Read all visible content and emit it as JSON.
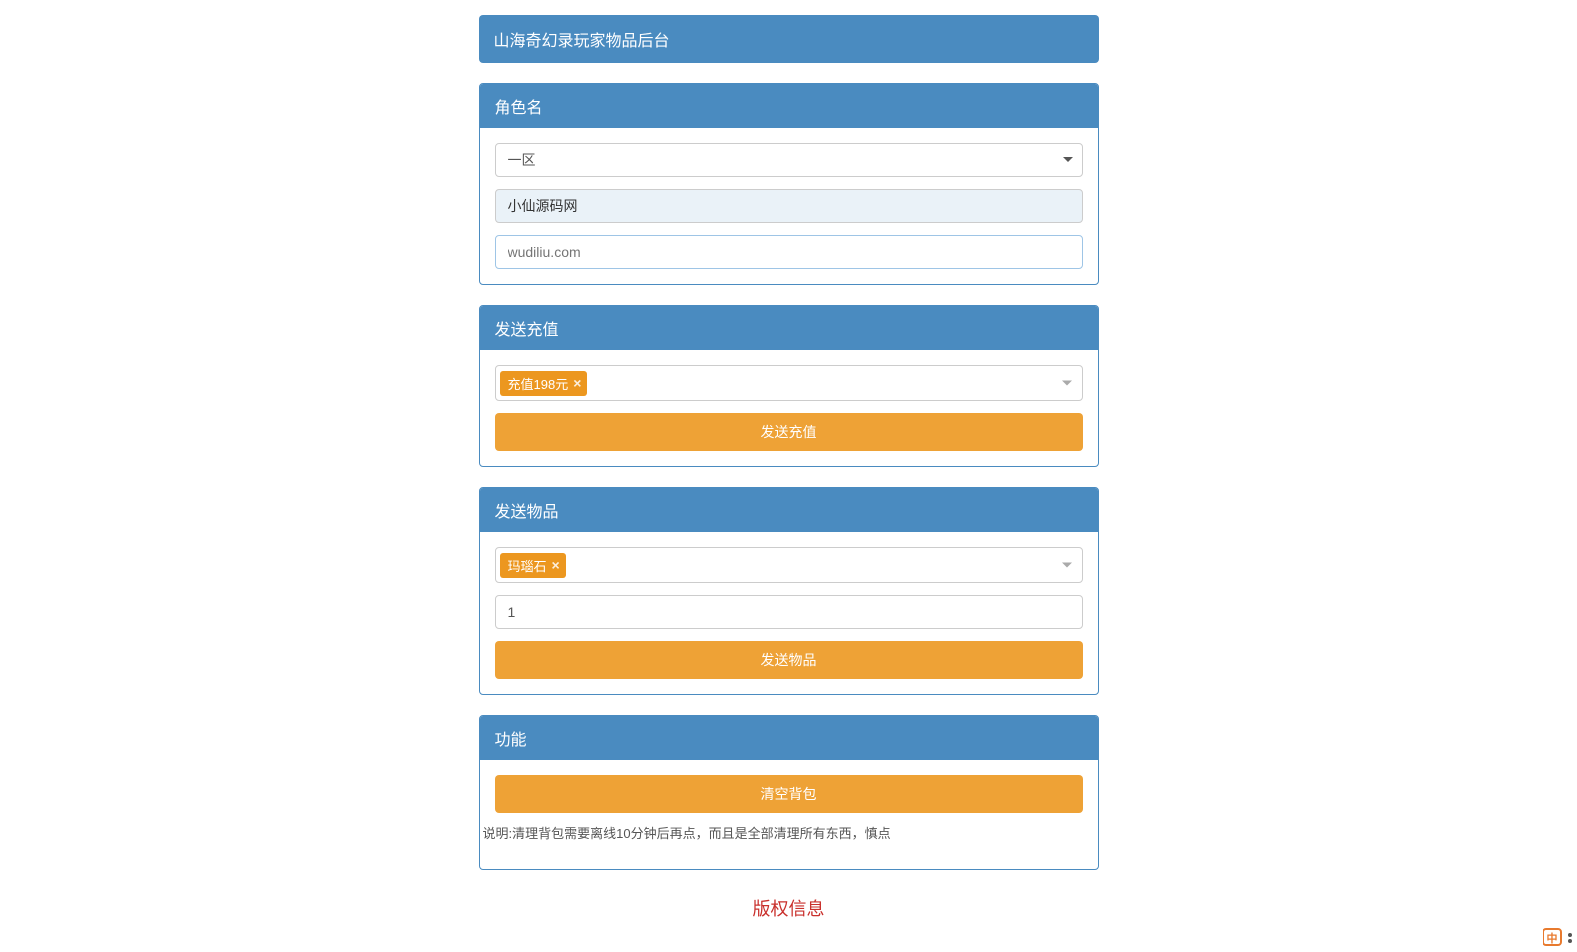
{
  "header": {
    "title": "山海奇幻录玩家物品后台"
  },
  "rolePanel": {
    "title": "角色名",
    "zoneSelect": {
      "selected": "一区"
    },
    "roleName": "小仙源码网",
    "accountPlaceholder": "wudiliu.com"
  },
  "rechargePanel": {
    "title": "发送充值",
    "selectedTag": "充值198元",
    "buttonLabel": "发送充值"
  },
  "itemPanel": {
    "title": "发送物品",
    "selectedTag": "玛瑙石",
    "quantityValue": "1",
    "buttonLabel": "发送物品"
  },
  "funcPanel": {
    "title": "功能",
    "clearBagLabel": "清空背包",
    "note": "说明:清理背包需要离线10分钟后再点，而且是全部清理所有东西，慎点"
  },
  "footer": {
    "copyright": "版权信息"
  }
}
